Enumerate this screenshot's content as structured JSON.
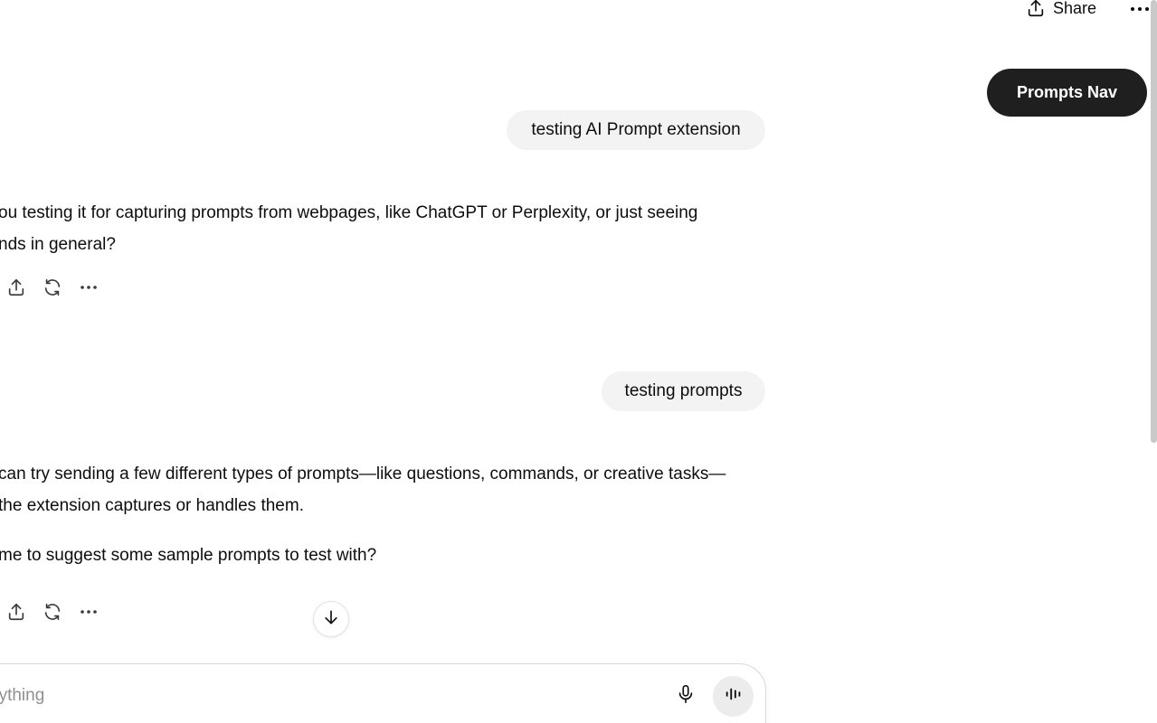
{
  "header": {
    "share_label": "Share",
    "share_icon": "share-upload-icon",
    "more_icon": "ellipsis-icon"
  },
  "extension": {
    "prompts_nav_label": "Prompts Nav"
  },
  "conversation": {
    "messages": [
      {
        "role": "user",
        "text": "testing AI Prompt extension"
      },
      {
        "role": "assistant",
        "lines": [
          "ou testing it for capturing prompts from webpages, like ChatGPT or Perplexity, or just seeing",
          "nds in general?"
        ]
      },
      {
        "role": "user",
        "text": "testing prompts"
      },
      {
        "role": "assistant",
        "lines": [
          "can try sending a few different types of prompts—like questions, commands, or creative tasks—",
          " the extension captures or handles them.",
          " me to suggest some sample prompts to test with?"
        ]
      }
    ],
    "action_icons": [
      "share-icon",
      "regenerate-icon",
      "more-options-icon"
    ]
  },
  "composer": {
    "placeholder": "nything",
    "mic_icon": "microphone-icon",
    "voice_icon": "voice-mode-icon"
  },
  "colors": {
    "bubble_bg": "#f3f3f3",
    "prompts_nav_bg": "#1f1f1f",
    "voice_btn_bg": "#ececec"
  }
}
